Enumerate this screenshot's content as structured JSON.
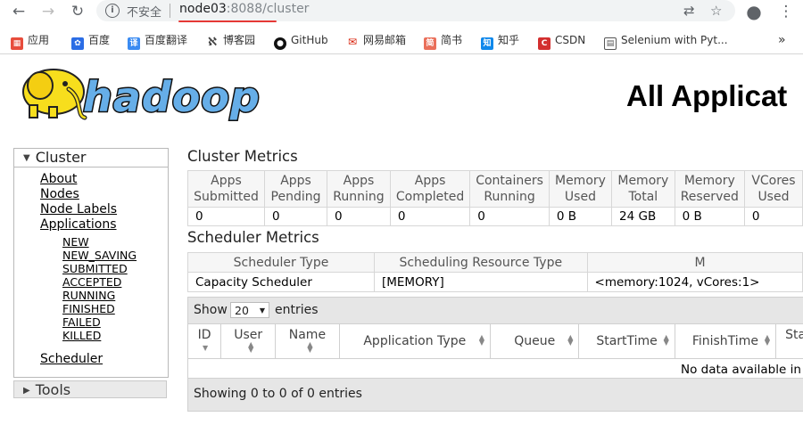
{
  "browser": {
    "insecure_label": "不安全",
    "url_host": "node03",
    "url_rest": ":8088/cluster",
    "bookmarks": [
      {
        "label": "应用",
        "icon": "apps-grid-icon",
        "color": "#e74c3c"
      },
      {
        "label": "百度",
        "icon": "baidu-paw-icon",
        "color": "#2b6de5"
      },
      {
        "label": "百度翻译",
        "icon": "translate-icon",
        "color": "#3a8bf2"
      },
      {
        "label": "博客园",
        "icon": "blog-icon",
        "color": "#444444"
      },
      {
        "label": "GitHub",
        "icon": "github-icon",
        "color": "#111111"
      },
      {
        "label": "网易邮箱",
        "icon": "mail-icon",
        "color": "#d81e06"
      },
      {
        "label": "简书",
        "icon": "jianshu-icon",
        "color": "#ea6f5a"
      },
      {
        "label": "知乎",
        "icon": "zhihu-icon",
        "color": "#0f88eb"
      },
      {
        "label": "CSDN",
        "icon": "csdn-icon",
        "color": "#d32f2f"
      },
      {
        "label": "Selenium with Pyt...",
        "icon": "selenium-icon",
        "color": "#555555"
      }
    ],
    "more": "»"
  },
  "header": {
    "title": "All Applicat",
    "logo_text": "hadoop"
  },
  "nav": {
    "cluster_label": "Cluster",
    "links": [
      "About",
      "Nodes",
      "Node Labels",
      "Applications"
    ],
    "app_states": [
      "NEW",
      "NEW_SAVING",
      "SUBMITTED",
      "ACCEPTED",
      "RUNNING",
      "FINISHED",
      "FAILED",
      "KILLED"
    ],
    "scheduler": "Scheduler",
    "tools_label": "Tools"
  },
  "cluster_metrics": {
    "title": "Cluster Metrics",
    "headers": [
      "Apps Submitted",
      "Apps Pending",
      "Apps Running",
      "Apps Completed",
      "Containers Running",
      "Memory Used",
      "Memory Total",
      "Memory Reserved",
      "VCores Used"
    ],
    "values": [
      "0",
      "0",
      "0",
      "0",
      "0",
      "0 B",
      "24 GB",
      "0 B",
      "0"
    ]
  },
  "scheduler_metrics": {
    "title": "Scheduler Metrics",
    "headers": [
      "Scheduler Type",
      "Scheduling Resource Type",
      "M"
    ],
    "values": [
      "Capacity Scheduler",
      "[MEMORY]",
      "<memory:1024, vCores:1>"
    ]
  },
  "apps_table": {
    "show_label": "Show",
    "entries_value": "20",
    "entries_label": "entries",
    "headers": [
      "ID",
      "User",
      "Name",
      "Application Type",
      "Queue",
      "StartTime",
      "FinishTime",
      "State"
    ],
    "empty_message": "No data available in table",
    "footer": "Showing 0 to 0 of 0 entries"
  }
}
